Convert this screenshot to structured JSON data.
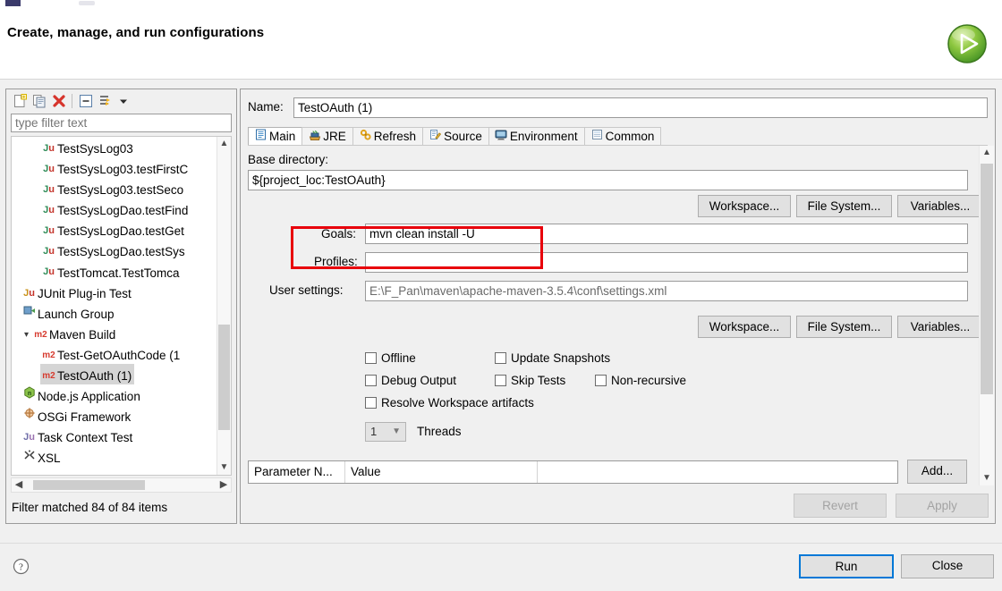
{
  "window": {
    "header_title": "Create, manage, and run configurations",
    "run_icon": "run-green-play-icon"
  },
  "tree_panel": {
    "toolbar": [
      {
        "name": "new-configuration-icon",
        "tip": "New launch configuration"
      },
      {
        "name": "duplicate-icon",
        "tip": "Duplicate"
      },
      {
        "name": "delete-icon",
        "tip": "Delete"
      },
      {
        "name": "collapse-all-icon",
        "tip": "Collapse All"
      },
      {
        "name": "filter-icon",
        "tip": "Filter"
      },
      {
        "name": "chevron-down-icon",
        "tip": "View menu"
      }
    ],
    "filter_value": "",
    "filter_placeholder": "type filter text",
    "items": [
      {
        "label": "TestSysLog03",
        "icon": "junit",
        "indent": 2,
        "arrow": "",
        "selected": false
      },
      {
        "label": "TestSysLog03.testFirstC",
        "icon": "junit",
        "indent": 2,
        "arrow": "",
        "selected": false
      },
      {
        "label": "TestSysLog03.testSeco",
        "icon": "junit",
        "indent": 2,
        "arrow": "",
        "selected": false
      },
      {
        "label": "TestSysLogDao.testFind",
        "icon": "junit",
        "indent": 2,
        "arrow": "",
        "selected": false
      },
      {
        "label": "TestSysLogDao.testGet",
        "icon": "junit",
        "indent": 2,
        "arrow": "",
        "selected": false
      },
      {
        "label": "TestSysLogDao.testSys",
        "icon": "junit",
        "indent": 2,
        "arrow": "",
        "selected": false
      },
      {
        "label": "TestTomcat.TestTomca",
        "icon": "junit",
        "indent": 2,
        "arrow": "",
        "selected": false
      },
      {
        "label": "JUnit Plug-in Test",
        "icon": "junitplug",
        "indent": 1,
        "arrow": "",
        "selected": false
      },
      {
        "label": "Launch Group",
        "icon": "launchgroup",
        "indent": 1,
        "arrow": "",
        "selected": false
      },
      {
        "label": "Maven Build",
        "icon": "m2",
        "indent": 1,
        "arrow": "v",
        "selected": false
      },
      {
        "label": "Test-GetOAuthCode (1",
        "icon": "m2",
        "indent": 2,
        "arrow": "",
        "selected": false
      },
      {
        "label": "TestOAuth (1)",
        "icon": "m2",
        "indent": 2,
        "arrow": "",
        "selected": true
      },
      {
        "label": "Node.js Application",
        "icon": "node",
        "indent": 1,
        "arrow": "",
        "selected": false
      },
      {
        "label": "OSGi Framework",
        "icon": "osgi",
        "indent": 1,
        "arrow": "",
        "selected": false
      },
      {
        "label": "Task Context Test",
        "icon": "taskctx",
        "indent": 1,
        "arrow": "",
        "selected": false
      },
      {
        "label": "XSL",
        "icon": "xsl",
        "indent": 1,
        "arrow": "",
        "selected": false
      }
    ],
    "status": "Filter matched 84 of 84 items"
  },
  "config_panel": {
    "name_label": "Name:",
    "name_value": "TestOAuth (1)",
    "tabs": [
      {
        "label": "Main",
        "icon": "main-tab-icon",
        "active": true
      },
      {
        "label": "JRE",
        "icon": "jre-tab-icon",
        "active": false
      },
      {
        "label": "Refresh",
        "icon": "refresh-tab-icon",
        "active": false
      },
      {
        "label": "Source",
        "icon": "source-tab-icon",
        "active": false
      },
      {
        "label": "Environment",
        "icon": "environment-tab-icon",
        "active": false
      },
      {
        "label": "Common",
        "icon": "common-tab-icon",
        "active": false
      }
    ],
    "main": {
      "base_directory_label": "Base directory:",
      "base_directory_value": "${project_loc:TestOAuth}",
      "browse_row_1": {
        "workspace": "Workspace...",
        "file_system": "File System...",
        "variables": "Variables..."
      },
      "goals_label": "Goals:",
      "goals_value": "mvn clean install -U",
      "profiles_label": "Profiles:",
      "profiles_value": "",
      "user_settings_label": "User settings:",
      "user_settings_value": "E:\\F_Pan\\maven\\apache-maven-3.5.4\\conf\\settings.xml",
      "browse_row_2": {
        "workspace": "Workspace...",
        "file_system": "File System...",
        "variables": "Variables..."
      },
      "checkboxes": [
        {
          "label": "Offline",
          "checked": false
        },
        {
          "label": "Update Snapshots",
          "checked": false
        },
        {
          "label": "Debug Output",
          "checked": false
        },
        {
          "label": "Skip Tests",
          "checked": false
        },
        {
          "label": "Non-recursive",
          "checked": false
        },
        {
          "label": "Resolve Workspace artifacts",
          "checked": false
        }
      ],
      "threads": {
        "value": "1",
        "label": "Threads"
      },
      "parameter_table": {
        "columns": [
          "Parameter N...",
          "Value",
          ""
        ],
        "rows": []
      },
      "add_button": "Add..."
    },
    "revert_label": "Revert",
    "apply_label": "Apply"
  },
  "footer": {
    "help_icon": "help-question-icon",
    "run_label": "Run",
    "close_label": "Close"
  },
  "annotation": {
    "shape": "rectangle",
    "color": "#e8000b",
    "target": "goals-field"
  }
}
